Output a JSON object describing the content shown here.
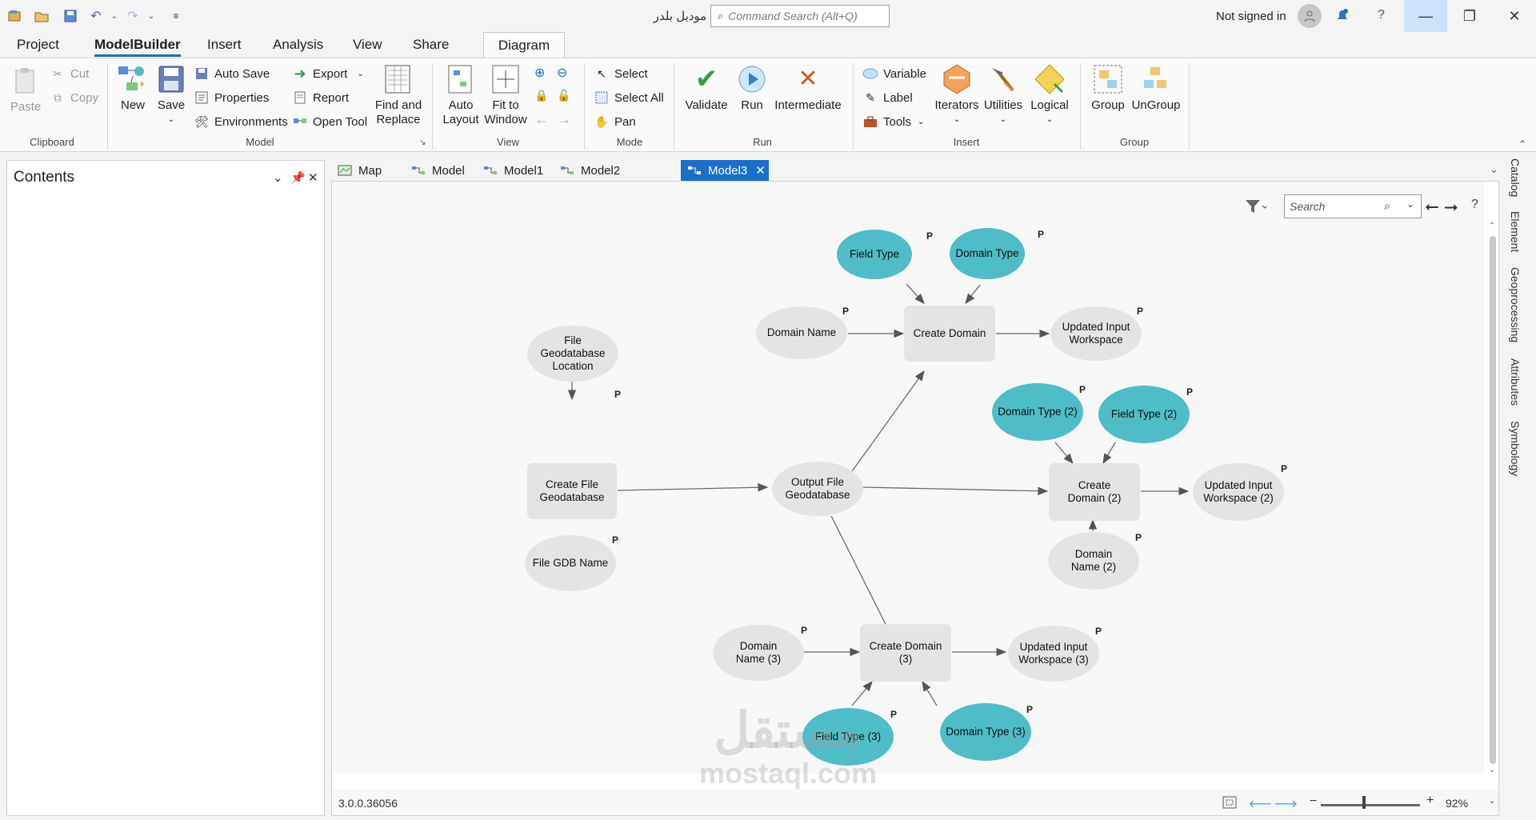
{
  "titlebar": {
    "app_title": "موديل بلدر",
    "command_search_placeholder": "Command Search (Alt+Q)",
    "signed_in_text": "Not signed in",
    "icons": [
      "new-project-icon",
      "open-project-icon",
      "save-project-icon",
      "undo-icon",
      "redo-icon",
      "customize-icon",
      "user-icon",
      "notification-icon",
      "help-icon"
    ]
  },
  "ribbon_tabs": [
    "Project",
    "ModelBuilder",
    "Insert",
    "Analysis",
    "View",
    "Share"
  ],
  "context_tab": "Diagram",
  "ribbon": {
    "clipboard": {
      "label": "Clipboard",
      "paste": "Paste",
      "cut": "Cut",
      "copy": "Copy"
    },
    "model": {
      "label": "Model",
      "new": "New",
      "save": "Save",
      "auto_save": "Auto Save",
      "properties": "Properties",
      "environments": "Environments",
      "export": "Export",
      "report": "Report",
      "open_tool": "Open Tool",
      "find_replace_1": "Find and",
      "find_replace_2": "Replace"
    },
    "view": {
      "label": "View",
      "auto_layout_1": "Auto",
      "auto_layout_2": "Layout",
      "fit_1": "Fit to",
      "fit_2": "Window"
    },
    "mode": {
      "label": "Mode",
      "select": "Select",
      "select_all": "Select All",
      "pan": "Pan"
    },
    "run": {
      "label": "Run",
      "validate": "Validate",
      "run": "Run",
      "intermediate": "Intermediate"
    },
    "insert": {
      "label": "Insert",
      "variable": "Variable",
      "label_btn": "Label",
      "tools": "Tools",
      "iterators": "Iterators",
      "utilities": "Utilities",
      "logical": "Logical"
    },
    "group": {
      "label": "Group",
      "group": "Group",
      "ungroup": "UnGroup"
    }
  },
  "contents": {
    "title": "Contents"
  },
  "doc_tabs": [
    "Map",
    "Model",
    "Model1",
    "Model2",
    "Model3"
  ],
  "active_doc_tab": "Model3",
  "canvas": {
    "search_placeholder": "Search",
    "version": "3.0.0.36056",
    "zoom": "92%"
  },
  "right_dock": [
    "Catalog",
    "Element",
    "Geoprocessing",
    "Attributes",
    "Symbology"
  ],
  "diagram": {
    "param_marker": "P",
    "nodes": {
      "field_type": "Field Type",
      "domain_type": "Domain Type",
      "domain_name": "Domain Name",
      "create_domain": "Create Domain",
      "updated_ws": "Updated Input Workspace",
      "file_gdb_location": "File Geodatabase Location",
      "create_file_gdb": "Create File Geodatabase",
      "file_gdb_name": "File GDB Name",
      "output_gdb": "Output File Geodatabase",
      "domain_type_2": "Domain Type (2)",
      "field_type_2": "Field Type (2)",
      "create_domain_2": "Create Domain (2)",
      "updated_ws_2": "Updated Input Workspace (2)",
      "domain_name_2": "Domain Name (2)",
      "domain_name_3": "Domain Name (3)",
      "create_domain_3": "Create Domain (3)",
      "updated_ws_3": "Updated Input Workspace (3)",
      "field_type_3": "Field Type (3)",
      "domain_type_3": "Domain Type (3)"
    }
  },
  "watermark": {
    "arabic": "مستقل",
    "latin": "mostaql.com"
  },
  "colors": {
    "accent": "#1a6fc9",
    "variable_blue": "#4fbdc8",
    "node_gray": "#e4e4e4"
  }
}
